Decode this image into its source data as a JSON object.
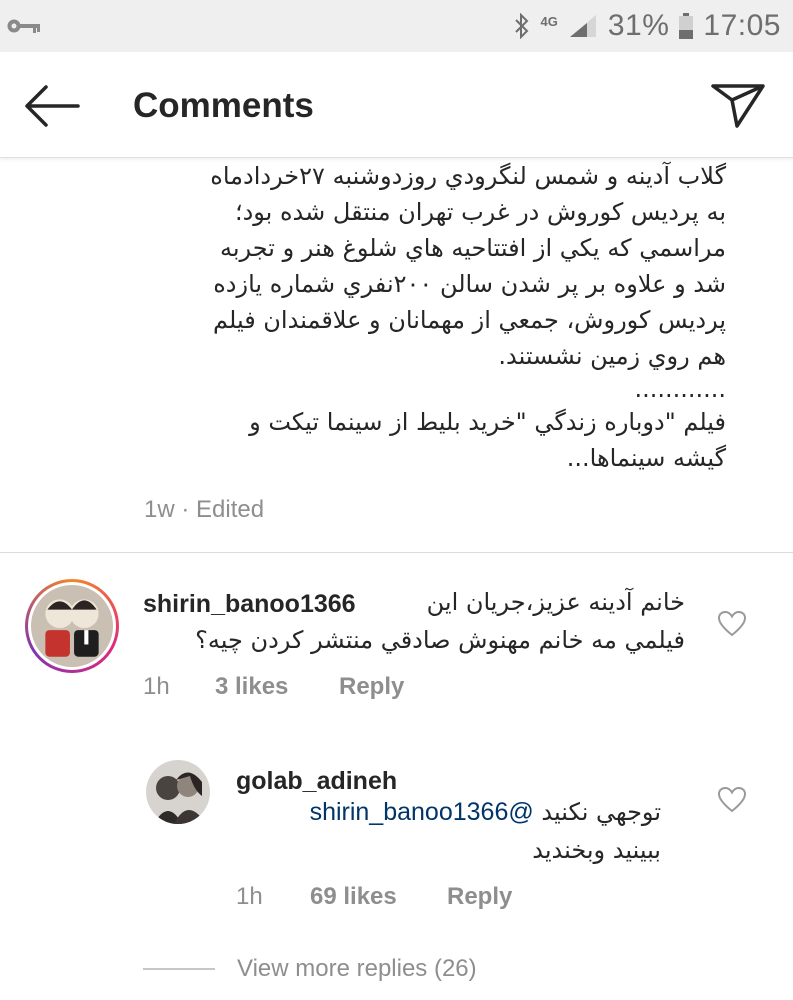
{
  "status_bar": {
    "network": "4G",
    "battery": "31%",
    "time": "17:05"
  },
  "header": {
    "title": "Comments"
  },
  "caption": {
    "lines": [
      "گلاب آدينه و شمس لنگرودي روزدوشنبه ٢٧خردادماه",
      "به پرديس كوروش در غرب تهران منتقل شده بود؛",
      "مراسمي كه يكي از افتتاحيه هاي شلوغ هنر و تجربه",
      "شد و علاوه بر پر شدن سالن ٢٠٠نفري شماره يازده",
      "پرديس كوروش، جمعي از مهمانان و علاقمندان فيلم",
      "هم روي زمين نشستند."
    ],
    "ellipsis": "............",
    "lines2": [
      "فيلم \"دوباره زندگي \"خريد بليط از سينما تيكت و",
      "گيشه سينماها..."
    ],
    "meta": "1w · Edited"
  },
  "comments": [
    {
      "username": "shirin_banoo1366",
      "text_lines": [
        "خانم آدينه عزيز،جريان اين",
        "فيلمي مه خانم مهنوش صادقي منتشر كردن چيه؟"
      ],
      "time": "1h",
      "likes": "3 likes",
      "reply": "Reply"
    }
  ],
  "reply": {
    "username": "golab_adineh",
    "mention": "@shirin_banoo1366",
    "text_first": "توجهي نكنيد",
    "text_second": "ببينيد وبخنديد",
    "time": "1h",
    "likes": "69 likes",
    "reply": "Reply"
  },
  "view_more": "View more replies (26)",
  "colors": {
    "text": "#262626",
    "muted": "#8e8e8e",
    "mention": "#003569",
    "status_bg": "#efefef"
  },
  "icons": {
    "status": [
      "key-icon",
      "bluetooth-icon",
      "signal-icon",
      "battery-icon"
    ],
    "header": [
      "back-arrow-icon",
      "direct-send-icon"
    ],
    "comment": [
      "heart-outline-icon"
    ]
  }
}
